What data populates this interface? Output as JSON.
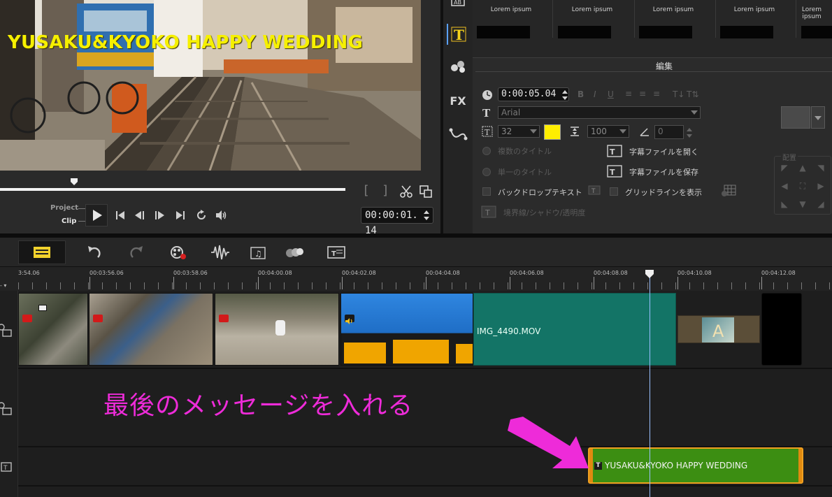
{
  "preview": {
    "overlay_title": "YUSAKU&KYOKO HAPPY WEDDING",
    "mode_project": "Project",
    "mode_clip": "Clip",
    "timecode": "00:00:01. 14"
  },
  "library": {
    "thumbnails": [
      "Lorem ipsum",
      "Lorem ipsum",
      "Lorem ipsum",
      "Lorem ipsum",
      "Lorem ipsum"
    ]
  },
  "edit_panel": {
    "tab_label": "編集",
    "duration": "0:00:05.04",
    "font": "Arial",
    "font_size": "32",
    "text_color": "#ffee00",
    "line_spacing": "100",
    "rotation": "0",
    "multi_title": "複数のタイトル",
    "single_title": "単一のタイトル",
    "open_subtitle": "字幕ファイルを開く",
    "save_subtitle": "字幕ファイルを保存",
    "backdrop_text": "バックドロップテキスト",
    "show_gridlines": "グリッドラインを表示",
    "border_shadow": "境界線/シャドウ/透明度",
    "placement": "配置"
  },
  "timeline": {
    "ruler": [
      "3:54.06",
      "00:03:56.06",
      "00:03:58.06",
      "00:04:00.08",
      "00:04:02.08",
      "00:04:04.08",
      "00:04:06.08",
      "00:04:08.08",
      "00:04:10.08",
      "00:04:12.08"
    ],
    "video_clip_name": "IMG_4490.MOV",
    "title_clip_text": "YUSAKU&KYOKO HAPPY WEDDING"
  },
  "annotation": {
    "text": "最後のメッセージを入れる",
    "color": "#ee2bd9"
  }
}
